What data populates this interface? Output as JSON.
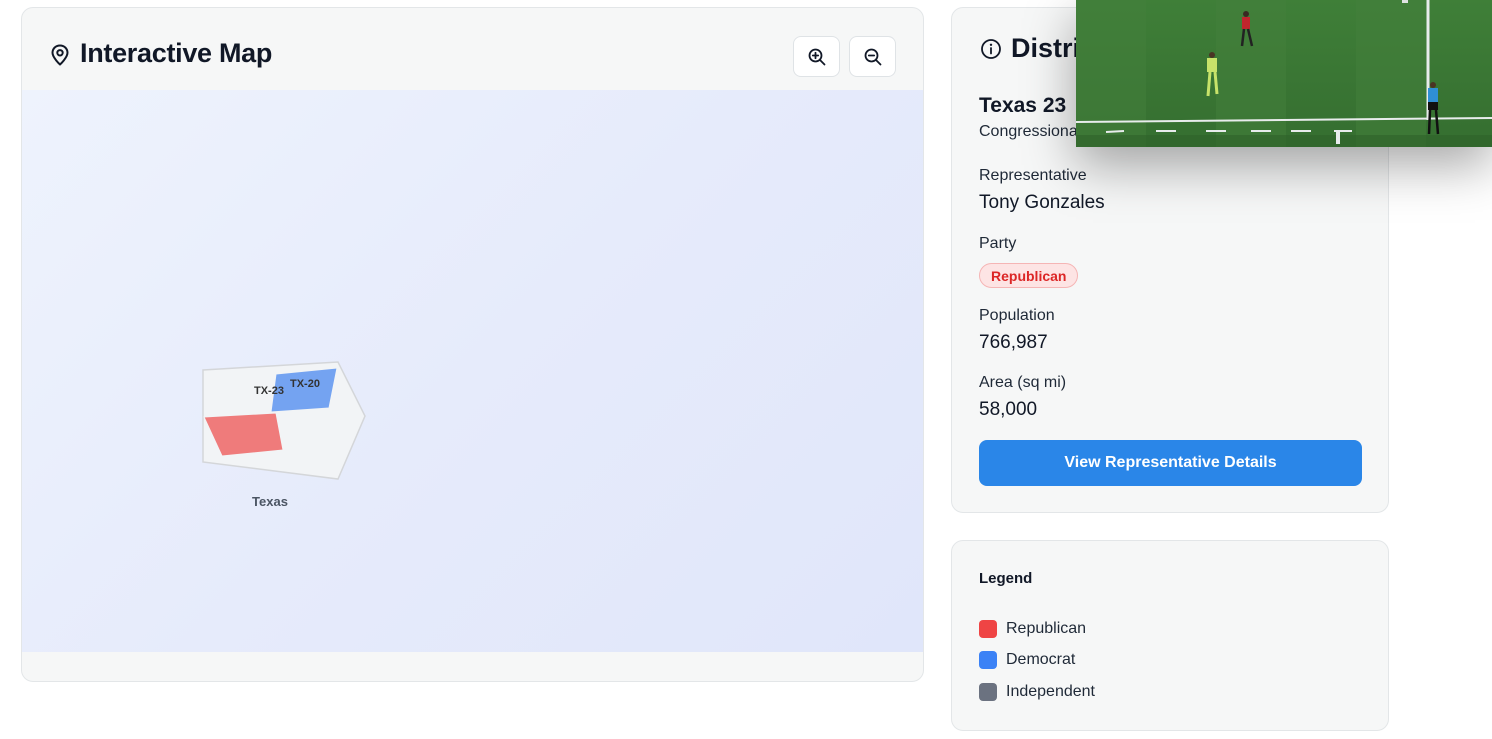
{
  "map": {
    "title": "Interactive Map",
    "zoom_in_label": "Zoom in",
    "zoom_out_label": "Zoom out",
    "state_label": "Texas",
    "districts": [
      {
        "id": "TX-23",
        "label": "TX-23",
        "party": "Republican",
        "color": "#ef7b7b"
      },
      {
        "id": "TX-20",
        "label": "TX-20",
        "party": "Democrat",
        "color": "#74a3f1"
      }
    ]
  },
  "district": {
    "header": "District Info",
    "name": "Texas 23",
    "type": "Congressional District",
    "representative_label": "Representative",
    "representative": "Tony Gonzales",
    "party_label": "Party",
    "party": "Republican",
    "population_label": "Population",
    "population": "766,987",
    "area_label": "Area (sq mi)",
    "area": "58,000",
    "details_button": "View Representative Details"
  },
  "legend": {
    "title": "Legend",
    "items": [
      {
        "label": "Republican",
        "color": "#ef4444"
      },
      {
        "label": "Democrat",
        "color": "#3b82f6"
      },
      {
        "label": "Independent",
        "color": "#6b7280"
      }
    ]
  },
  "colors": {
    "accent": "#2a86e8",
    "republican": "#ef4444",
    "democrat": "#3b82f6",
    "independent": "#6b7280"
  }
}
